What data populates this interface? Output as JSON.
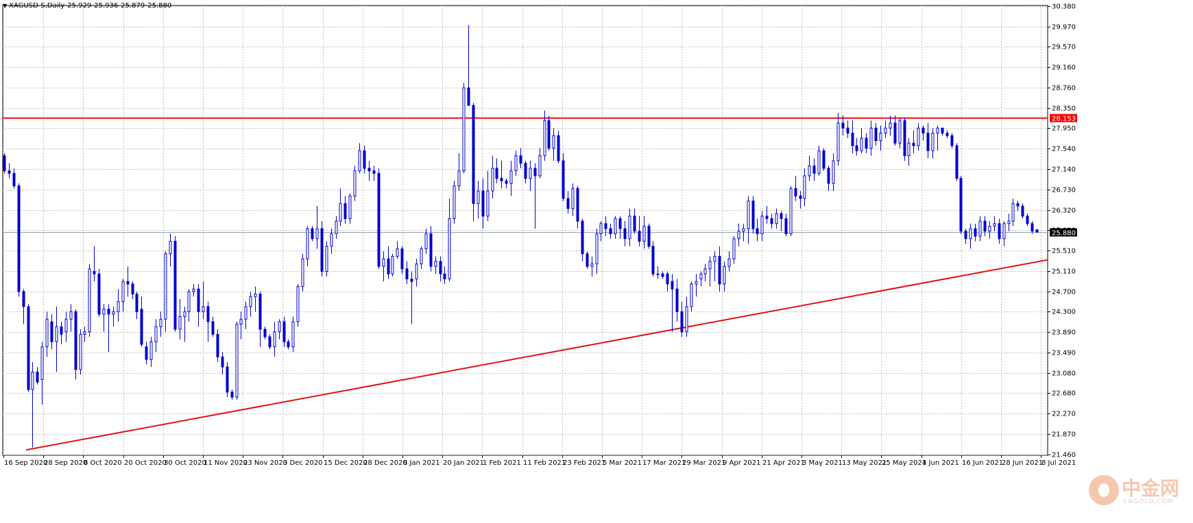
{
  "header": {
    "symbol": "XAGUSD-S,Daily",
    "open": "25.929",
    "high": "25.936",
    "low": "25.879",
    "close": "25.880"
  },
  "colors": {
    "candle": "#0000cd",
    "grid": "#c0c0c0",
    "resistance": "#ff0000",
    "support": "#e01010",
    "price_label_bg": "#000000",
    "resistance_label_bg": "#ff0000"
  },
  "watermark": {
    "chinese": "中金网",
    "site": "CNGOLD.COM"
  },
  "chart_data": {
    "type": "candlestick",
    "symbol": "XAGUSD-S",
    "timeframe": "Daily",
    "grid": true,
    "ylim": [
      21.445,
      30.388
    ],
    "y_ticks": [
      "30.380",
      "29.970",
      "29.570",
      "29.160",
      "28.760",
      "28.350",
      "27.950",
      "27.540",
      "27.140",
      "26.730",
      "26.320",
      "25.920",
      "25.510",
      "25.110",
      "24.700",
      "24.300",
      "23.890",
      "23.490",
      "23.080",
      "22.680",
      "22.270",
      "21.870",
      "21.460"
    ],
    "x_ticks": [
      "16 Sep 2020",
      "28 Sep 2020",
      "8 Oct 2020",
      "20 Oct 2020",
      "30 Oct 2020",
      "11 Nov 2020",
      "23 Nov 2020",
      "3 Dec 2020",
      "15 Dec 2020",
      "28 Dec 2020",
      "8 Jan 2021",
      "20 Jan 2021",
      "1 Feb 2021",
      "11 Feb 2021",
      "23 Feb 2021",
      "5 Mar 2021",
      "17 Mar 2021",
      "29 Mar 2021",
      "9 Apr 2021",
      "21 Apr 2021",
      "3 May 2021",
      "13 May 2021",
      "25 May 2021",
      "4 Jun 2021",
      "16 Jun 2021",
      "28 Jun 2021",
      "8 Jul 2021"
    ],
    "current_price": "25.880",
    "resistance": {
      "price": "28.153",
      "value": 28.153
    },
    "support_line": {
      "from": {
        "x": "17 Sep 2020",
        "y": 21.55
      },
      "to": {
        "x": "9 Jul 2021",
        "y": 25.33
      }
    },
    "ohlc": [
      [
        27.4,
        27.45,
        27.05,
        27.1
      ],
      [
        27.1,
        27.25,
        26.95,
        27.05
      ],
      [
        27.05,
        27.15,
        26.75,
        26.8
      ],
      [
        26.8,
        26.85,
        24.6,
        24.7
      ],
      [
        24.7,
        24.75,
        24.05,
        24.4
      ],
      [
        24.4,
        24.45,
        22.7,
        22.75
      ],
      [
        22.75,
        23.3,
        21.6,
        23.1
      ],
      [
        23.1,
        23.2,
        22.85,
        22.9
      ],
      [
        22.95,
        23.7,
        22.45,
        23.6
      ],
      [
        23.6,
        24.3,
        23.4,
        24.15
      ],
      [
        24.1,
        24.25,
        23.55,
        23.7
      ],
      [
        23.7,
        24.4,
        23.1,
        24.0
      ],
      [
        24.0,
        24.1,
        23.65,
        23.85
      ],
      [
        23.9,
        24.3,
        23.7,
        24.15
      ],
      [
        24.15,
        24.45,
        23.9,
        24.3
      ],
      [
        24.3,
        24.35,
        22.95,
        23.15
      ],
      [
        23.15,
        23.95,
        23.05,
        23.85
      ],
      [
        23.85,
        24.0,
        23.7,
        23.9
      ],
      [
        23.9,
        25.25,
        23.8,
        25.15
      ],
      [
        25.1,
        25.6,
        24.9,
        25.05
      ],
      [
        25.05,
        25.15,
        24.2,
        24.25
      ],
      [
        24.25,
        24.45,
        23.9,
        24.35
      ],
      [
        24.35,
        24.45,
        23.5,
        24.25
      ],
      [
        24.25,
        24.4,
        24.0,
        24.3
      ],
      [
        24.3,
        24.75,
        24.1,
        24.5
      ],
      [
        24.5,
        24.95,
        24.3,
        24.9
      ],
      [
        24.9,
        25.2,
        24.6,
        24.85
      ],
      [
        24.85,
        24.9,
        24.55,
        24.65
      ],
      [
        24.65,
        24.7,
        24.15,
        24.3
      ],
      [
        24.35,
        24.6,
        23.6,
        23.65
      ],
      [
        23.6,
        23.7,
        23.25,
        23.35
      ],
      [
        23.35,
        23.8,
        23.2,
        23.7
      ],
      [
        23.7,
        24.15,
        23.5,
        24.0
      ],
      [
        24.0,
        24.3,
        23.8,
        24.15
      ],
      [
        24.15,
        25.5,
        23.9,
        25.45
      ],
      [
        25.45,
        25.85,
        25.2,
        25.7
      ],
      [
        25.7,
        25.8,
        23.9,
        23.95
      ],
      [
        23.95,
        24.55,
        23.75,
        24.2
      ],
      [
        24.2,
        24.4,
        23.7,
        24.3
      ],
      [
        24.3,
        24.75,
        24.1,
        24.7
      ],
      [
        24.7,
        24.85,
        24.6,
        24.75
      ],
      [
        24.75,
        24.85,
        24.0,
        24.3
      ],
      [
        24.3,
        24.9,
        24.15,
        24.4
      ],
      [
        24.4,
        24.5,
        23.7,
        24.1
      ],
      [
        24.1,
        24.2,
        23.8,
        23.85
      ],
      [
        23.85,
        23.95,
        23.3,
        23.4
      ],
      [
        23.4,
        23.5,
        23.05,
        23.2
      ],
      [
        23.2,
        23.3,
        22.6,
        22.7
      ],
      [
        22.7,
        22.75,
        22.55,
        22.6
      ],
      [
        22.6,
        24.1,
        22.55,
        24.05
      ],
      [
        24.05,
        24.3,
        23.75,
        24.15
      ],
      [
        24.15,
        24.5,
        23.95,
        24.4
      ],
      [
        24.4,
        24.7,
        24.2,
        24.6
      ],
      [
        24.6,
        24.8,
        24.3,
        24.65
      ],
      [
        24.65,
        24.7,
        23.6,
        23.95
      ],
      [
        23.95,
        24.0,
        23.75,
        23.8
      ],
      [
        23.8,
        23.85,
        23.55,
        23.6
      ],
      [
        23.6,
        24.1,
        23.4,
        23.9
      ],
      [
        23.9,
        24.15,
        23.75,
        24.1
      ],
      [
        24.1,
        24.2,
        23.6,
        23.7
      ],
      [
        23.7,
        23.75,
        23.55,
        23.6
      ],
      [
        23.6,
        24.2,
        23.5,
        24.1
      ],
      [
        24.1,
        24.85,
        24.0,
        24.8
      ],
      [
        24.8,
        25.45,
        24.7,
        25.35
      ],
      [
        25.35,
        26.0,
        25.2,
        25.95
      ],
      [
        25.95,
        26.0,
        25.7,
        25.75
      ],
      [
        25.75,
        26.4,
        25.55,
        25.95
      ],
      [
        25.95,
        26.1,
        25.0,
        25.1
      ],
      [
        25.1,
        25.7,
        25.0,
        25.6
      ],
      [
        25.6,
        25.95,
        25.45,
        25.85
      ],
      [
        25.85,
        26.2,
        25.75,
        26.1
      ],
      [
        26.1,
        26.75,
        26.0,
        26.45
      ],
      [
        26.45,
        26.6,
        26.05,
        26.15
      ],
      [
        26.15,
        26.65,
        26.05,
        26.6
      ],
      [
        26.6,
        27.2,
        26.5,
        27.1
      ],
      [
        27.1,
        27.65,
        27.05,
        27.5
      ],
      [
        27.5,
        27.6,
        27.05,
        27.15
      ],
      [
        27.15,
        27.3,
        26.9,
        27.1
      ],
      [
        27.1,
        27.2,
        26.9,
        27.05
      ],
      [
        27.05,
        27.15,
        25.15,
        25.2
      ],
      [
        25.2,
        25.5,
        24.9,
        25.35
      ],
      [
        25.35,
        25.6,
        24.95,
        25.05
      ],
      [
        25.05,
        25.45,
        25.0,
        25.4
      ],
      [
        25.4,
        25.7,
        25.35,
        25.55
      ],
      [
        25.55,
        25.6,
        25.05,
        25.15
      ],
      [
        25.15,
        25.3,
        24.85,
        24.95
      ],
      [
        24.95,
        25.1,
        24.05,
        24.9
      ],
      [
        24.95,
        25.35,
        24.8,
        25.25
      ],
      [
        25.25,
        25.6,
        25.15,
        25.55
      ],
      [
        25.55,
        25.95,
        25.45,
        25.85
      ],
      [
        25.85,
        26.0,
        25.1,
        25.2
      ],
      [
        25.2,
        25.4,
        25.05,
        25.3
      ],
      [
        25.3,
        25.4,
        24.9,
        25.05
      ],
      [
        25.05,
        25.2,
        24.85,
        24.95
      ],
      [
        24.95,
        26.55,
        24.9,
        26.15
      ],
      [
        26.15,
        26.9,
        26.05,
        26.8
      ],
      [
        26.8,
        27.45,
        26.7,
        27.1
      ],
      [
        27.1,
        28.85,
        27.05,
        28.75
      ],
      [
        28.75,
        30.0,
        28.5,
        28.4
      ],
      [
        28.4,
        28.45,
        26.1,
        26.45
      ],
      [
        26.45,
        26.9,
        26.15,
        26.7
      ],
      [
        26.7,
        26.95,
        25.95,
        26.2
      ],
      [
        26.2,
        27.1,
        26.1,
        26.7
      ],
      [
        26.7,
        27.4,
        26.55,
        27.15
      ],
      [
        27.15,
        27.35,
        26.85,
        26.95
      ],
      [
        26.95,
        27.3,
        26.75,
        26.9
      ],
      [
        26.9,
        26.95,
        26.75,
        26.85
      ],
      [
        26.85,
        27.3,
        26.6,
        27.1
      ],
      [
        27.1,
        27.5,
        27.0,
        27.4
      ],
      [
        27.4,
        27.55,
        27.15,
        27.25
      ],
      [
        27.25,
        27.3,
        26.85,
        26.95
      ],
      [
        26.95,
        27.3,
        26.7,
        27.15
      ],
      [
        27.15,
        27.25,
        25.95,
        27.0
      ],
      [
        27.0,
        27.55,
        26.95,
        27.4
      ],
      [
        27.4,
        28.3,
        27.3,
        28.1
      ],
      [
        28.1,
        28.2,
        27.5,
        27.55
      ],
      [
        27.55,
        27.95,
        27.3,
        27.8
      ],
      [
        27.8,
        27.9,
        27.25,
        27.3
      ],
      [
        27.3,
        27.45,
        26.5,
        26.55
      ],
      [
        26.55,
        26.7,
        26.25,
        26.35
      ],
      [
        26.35,
        26.85,
        26.2,
        26.75
      ],
      [
        26.75,
        26.8,
        25.95,
        26.1
      ],
      [
        26.1,
        26.15,
        25.3,
        25.45
      ],
      [
        25.45,
        25.5,
        25.15,
        25.2
      ],
      [
        25.2,
        25.4,
        25.0,
        25.25
      ],
      [
        25.25,
        25.95,
        25.05,
        25.85
      ],
      [
        25.85,
        26.1,
        25.7,
        26.05
      ],
      [
        26.05,
        26.2,
        25.8,
        25.95
      ],
      [
        25.95,
        26.05,
        25.75,
        25.85
      ],
      [
        25.85,
        26.2,
        25.75,
        26.15
      ],
      [
        26.15,
        26.2,
        25.75,
        25.95
      ],
      [
        25.95,
        26.1,
        25.6,
        25.75
      ],
      [
        25.75,
        26.35,
        25.6,
        26.2
      ],
      [
        26.2,
        26.35,
        25.85,
        25.9
      ],
      [
        25.9,
        26.2,
        25.6,
        25.7
      ],
      [
        25.7,
        26.2,
        25.55,
        26.0
      ],
      [
        26.0,
        26.05,
        25.55,
        25.6
      ],
      [
        25.6,
        25.7,
        25.0,
        25.05
      ],
      [
        25.05,
        25.2,
        24.95,
        25.05
      ],
      [
        25.05,
        25.1,
        24.95,
        25.0
      ],
      [
        25.05,
        25.1,
        24.7,
        24.85
      ],
      [
        24.9,
        25.05,
        23.9,
        24.75
      ],
      [
        24.75,
        24.95,
        24.1,
        24.3
      ],
      [
        24.3,
        24.5,
        23.8,
        23.9
      ],
      [
        23.9,
        24.6,
        23.8,
        24.4
      ],
      [
        24.4,
        24.9,
        24.3,
        24.85
      ],
      [
        24.85,
        25.05,
        24.6,
        24.9
      ],
      [
        24.95,
        25.1,
        24.8,
        25.05
      ],
      [
        25.05,
        25.25,
        24.9,
        25.15
      ],
      [
        25.15,
        25.4,
        24.8,
        25.3
      ],
      [
        25.3,
        25.5,
        24.9,
        25.4
      ],
      [
        25.4,
        25.6,
        24.7,
        24.85
      ],
      [
        24.85,
        25.3,
        24.7,
        25.2
      ],
      [
        25.2,
        25.5,
        25.1,
        25.35
      ],
      [
        25.35,
        25.8,
        25.25,
        25.75
      ],
      [
        25.75,
        26.05,
        25.6,
        25.9
      ],
      [
        25.9,
        26.05,
        25.7,
        25.95
      ],
      [
        25.95,
        26.6,
        25.65,
        26.5
      ],
      [
        26.5,
        26.6,
        25.85,
        25.95
      ],
      [
        25.95,
        26.15,
        25.7,
        25.85
      ],
      [
        25.85,
        26.3,
        25.7,
        26.2
      ],
      [
        26.2,
        26.4,
        26.05,
        26.15
      ],
      [
        26.15,
        26.25,
        25.95,
        26.05
      ],
      [
        26.05,
        26.35,
        25.95,
        26.25
      ],
      [
        26.25,
        26.3,
        25.9,
        26.15
      ],
      [
        26.15,
        26.25,
        25.8,
        25.85
      ],
      [
        25.85,
        26.8,
        25.8,
        26.75
      ],
      [
        26.75,
        27.0,
        26.5,
        26.6
      ],
      [
        26.6,
        26.7,
        26.35,
        26.55
      ],
      [
        26.55,
        27.15,
        26.4,
        27.0
      ],
      [
        27.0,
        27.4,
        26.9,
        27.2
      ],
      [
        27.2,
        27.35,
        26.9,
        27.05
      ],
      [
        27.05,
        27.6,
        27.0,
        27.5
      ],
      [
        27.5,
        27.55,
        27.1,
        27.15
      ],
      [
        27.15,
        27.2,
        26.7,
        26.85
      ],
      [
        26.85,
        27.45,
        26.7,
        27.3
      ],
      [
        27.3,
        28.25,
        27.2,
        28.05
      ],
      [
        28.05,
        28.2,
        27.8,
        27.95
      ],
      [
        27.95,
        28.1,
        27.75,
        27.85
      ],
      [
        27.85,
        28.1,
        27.45,
        27.6
      ],
      [
        27.6,
        27.75,
        27.4,
        27.5
      ],
      [
        27.5,
        27.95,
        27.45,
        27.75
      ],
      [
        27.75,
        27.85,
        27.45,
        27.55
      ],
      [
        27.55,
        28.1,
        27.4,
        27.95
      ],
      [
        27.95,
        28.05,
        27.6,
        27.7
      ],
      [
        27.7,
        28.0,
        27.5,
        27.85
      ],
      [
        27.85,
        28.1,
        27.75,
        27.95
      ],
      [
        27.95,
        28.2,
        27.8,
        28.05
      ],
      [
        28.05,
        28.2,
        27.6,
        27.65
      ],
      [
        27.65,
        28.15,
        27.55,
        28.1
      ],
      [
        28.1,
        28.15,
        27.3,
        27.4
      ],
      [
        27.4,
        27.75,
        27.2,
        27.65
      ],
      [
        27.65,
        27.9,
        27.45,
        27.6
      ],
      [
        27.6,
        28.05,
        27.5,
        27.95
      ],
      [
        27.95,
        28.0,
        27.7,
        27.85
      ],
      [
        27.85,
        28.05,
        27.35,
        27.5
      ],
      [
        27.5,
        27.95,
        27.35,
        27.85
      ],
      [
        27.85,
        28.0,
        27.5,
        27.95
      ],
      [
        27.95,
        27.95,
        27.8,
        27.85
      ],
      [
        27.85,
        27.9,
        27.75,
        27.8
      ],
      [
        27.8,
        27.85,
        27.55,
        27.6
      ],
      [
        27.6,
        27.65,
        26.9,
        26.95
      ],
      [
        26.95,
        27.0,
        25.85,
        25.9
      ],
      [
        25.9,
        25.95,
        25.65,
        25.75
      ],
      [
        25.75,
        26.05,
        25.55,
        25.95
      ],
      [
        25.95,
        26.05,
        25.7,
        25.8
      ],
      [
        25.8,
        26.2,
        25.7,
        26.1
      ],
      [
        26.1,
        26.2,
        25.8,
        25.9
      ],
      [
        25.9,
        26.1,
        25.75,
        26.0
      ],
      [
        26.0,
        26.2,
        25.9,
        26.05
      ],
      [
        26.05,
        26.15,
        25.65,
        25.75
      ],
      [
        25.75,
        26.1,
        25.6,
        26.05
      ],
      [
        26.05,
        26.25,
        25.9,
        26.1
      ],
      [
        26.1,
        26.55,
        26.0,
        26.45
      ],
      [
        26.45,
        26.5,
        26.3,
        26.4
      ],
      [
        26.4,
        26.45,
        26.15,
        26.2
      ],
      [
        26.2,
        26.25,
        26.0,
        26.05
      ],
      [
        26.05,
        26.1,
        25.85,
        25.9
      ],
      [
        25.929,
        25.936,
        25.879,
        25.88
      ]
    ]
  }
}
